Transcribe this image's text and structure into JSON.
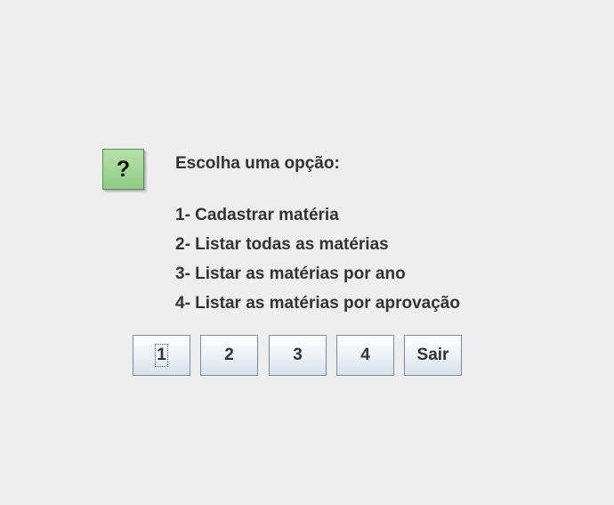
{
  "dialog": {
    "icon": "question-icon",
    "icon_glyph": "?",
    "icon_color": "#9fd494",
    "prompt": "Escolha uma opção:",
    "options": [
      "1- Cadastrar matéria",
      "2- Listar todas as matérias",
      "3- Listar as matérias por ano",
      "4- Listar as matérias por aprovação"
    ]
  },
  "buttons": [
    {
      "label": "1",
      "focused": true
    },
    {
      "label": "2",
      "focused": false
    },
    {
      "label": "3",
      "focused": false
    },
    {
      "label": "4",
      "focused": false
    },
    {
      "label": "Sair",
      "focused": false
    }
  ]
}
